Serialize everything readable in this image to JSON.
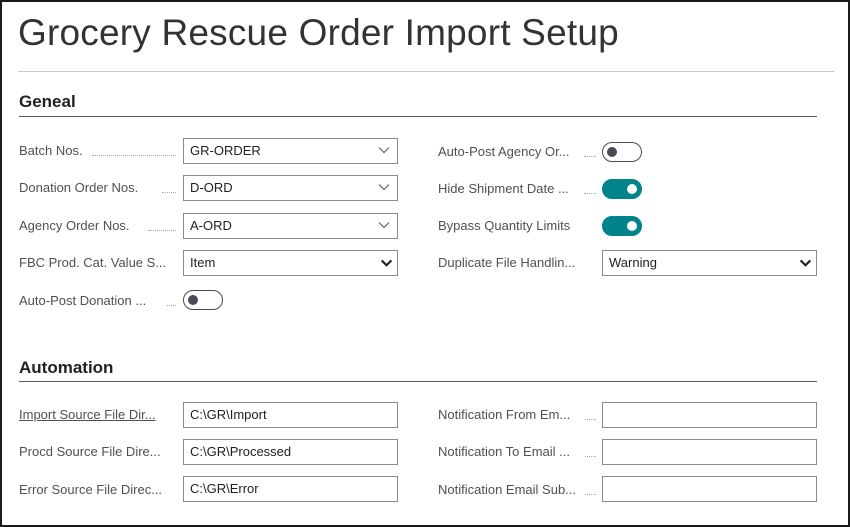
{
  "page": {
    "title": "Grocery Rescue Order Import Setup"
  },
  "general": {
    "section_title": "Geneal",
    "batch_nos": {
      "label": "Batch Nos.",
      "value": "GR-ORDER"
    },
    "donation_order_nos": {
      "label": "Donation Order Nos.",
      "value": "D-ORD"
    },
    "agency_order_nos": {
      "label": "Agency Order Nos.",
      "value": "A-ORD"
    },
    "fbc_prod_cat": {
      "label": "FBC Prod. Cat. Value S...",
      "value": "Item"
    },
    "auto_post_donation": {
      "label": "Auto-Post Donation ...",
      "on": false
    },
    "auto_post_agency": {
      "label": "Auto-Post Agency Or...",
      "on": false
    },
    "hide_shipment_date": {
      "label": "Hide Shipment Date ...",
      "on": true
    },
    "bypass_quantity_limits": {
      "label": "Bypass Quantity Limits",
      "on": true
    },
    "duplicate_file_handling": {
      "label": "Duplicate File Handlin...",
      "value": "Warning"
    }
  },
  "automation": {
    "section_title": "Automation",
    "import_source": {
      "label": "Import Source File Dir...",
      "value": "C:\\GR\\Import"
    },
    "procd_source": {
      "label": "Procd Source File Dire...",
      "value": "C:\\GR\\Processed"
    },
    "error_source": {
      "label": "Error Source File Direc...",
      "value": "C:\\GR\\Error"
    },
    "notification_from": {
      "label": "Notification From Em...",
      "value": ""
    },
    "notification_to": {
      "label": "Notification To Email ...",
      "value": ""
    },
    "notification_subject": {
      "label": "Notification Email Sub...",
      "value": ""
    }
  },
  "colors": {
    "toggle_on": "#00838a",
    "toggle_off_knob": "#4a4a55"
  }
}
